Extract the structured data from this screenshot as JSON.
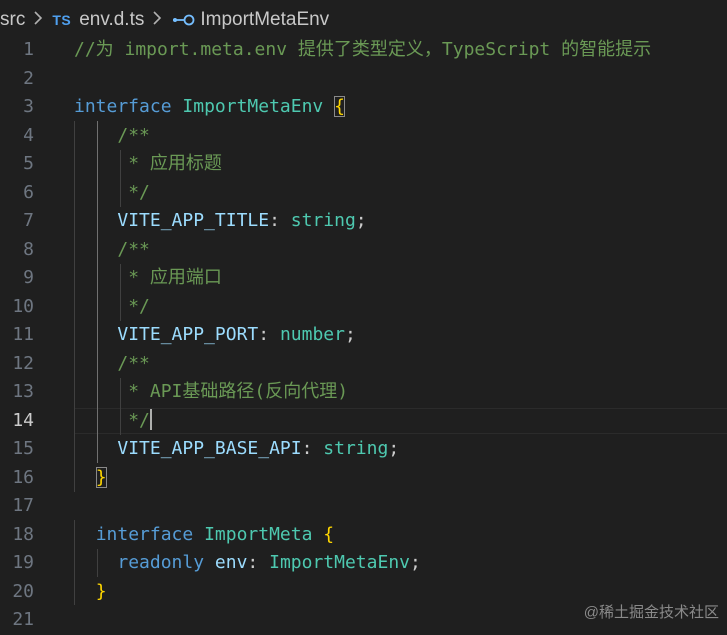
{
  "breadcrumb": {
    "folder": "src",
    "file_badge": "TS",
    "file": "env.d.ts",
    "symbol": "ImportMetaEnv",
    "separator_icon": "chevron-right-icon",
    "symbol_icon": "interface-icon"
  },
  "lines": [
    {
      "n": "1",
      "tokens": [
        {
          "c": "cm",
          "t": "//为 import.meta.env 提供了类型定义，TypeScript 的智能提示"
        }
      ]
    },
    {
      "n": "2",
      "tokens": []
    },
    {
      "n": "3",
      "tokens": [
        {
          "c": "kw",
          "t": "interface"
        },
        {
          "c": "",
          "t": " "
        },
        {
          "c": "ty",
          "t": "ImportMetaEnv"
        },
        {
          "c": "",
          "t": " "
        },
        {
          "c": "br-box",
          "t": "{"
        }
      ]
    },
    {
      "n": "4",
      "tokens": [
        {
          "c": "",
          "t": "    "
        },
        {
          "c": "cm",
          "t": "/**"
        }
      ]
    },
    {
      "n": "5",
      "tokens": [
        {
          "c": "",
          "t": "     "
        },
        {
          "c": "cm",
          "t": "* 应用标题"
        }
      ]
    },
    {
      "n": "6",
      "tokens": [
        {
          "c": "",
          "t": "     "
        },
        {
          "c": "cm",
          "t": "*/"
        }
      ]
    },
    {
      "n": "7",
      "tokens": [
        {
          "c": "",
          "t": "    "
        },
        {
          "c": "var",
          "t": "VITE_APP_TITLE"
        },
        {
          "c": "",
          "t": ": "
        },
        {
          "c": "ty",
          "t": "string"
        },
        {
          "c": "",
          "t": ";"
        }
      ]
    },
    {
      "n": "8",
      "tokens": [
        {
          "c": "",
          "t": "    "
        },
        {
          "c": "cm",
          "t": "/**"
        }
      ]
    },
    {
      "n": "9",
      "tokens": [
        {
          "c": "",
          "t": "     "
        },
        {
          "c": "cm",
          "t": "* 应用端口"
        }
      ]
    },
    {
      "n": "10",
      "tokens": [
        {
          "c": "",
          "t": "     "
        },
        {
          "c": "cm",
          "t": "*/"
        }
      ]
    },
    {
      "n": "11",
      "tokens": [
        {
          "c": "",
          "t": "    "
        },
        {
          "c": "var",
          "t": "VITE_APP_PORT"
        },
        {
          "c": "",
          "t": ": "
        },
        {
          "c": "ty",
          "t": "number"
        },
        {
          "c": "",
          "t": ";"
        }
      ]
    },
    {
      "n": "12",
      "tokens": [
        {
          "c": "",
          "t": "    "
        },
        {
          "c": "cm",
          "t": "/**"
        }
      ]
    },
    {
      "n": "13",
      "tokens": [
        {
          "c": "",
          "t": "     "
        },
        {
          "c": "cm",
          "t": "* API基础路径(反向代理)"
        }
      ]
    },
    {
      "n": "14",
      "tokens": [
        {
          "c": "",
          "t": "     "
        },
        {
          "c": "cm",
          "t": "*/"
        },
        {
          "c": "caret",
          "t": ""
        }
      ]
    },
    {
      "n": "15",
      "tokens": [
        {
          "c": "",
          "t": "    "
        },
        {
          "c": "var",
          "t": "VITE_APP_BASE_API"
        },
        {
          "c": "",
          "t": ": "
        },
        {
          "c": "ty",
          "t": "string"
        },
        {
          "c": "",
          "t": ";"
        }
      ]
    },
    {
      "n": "16",
      "tokens": [
        {
          "c": "",
          "t": "  "
        },
        {
          "c": "br-box",
          "t": "}"
        }
      ]
    },
    {
      "n": "17",
      "tokens": []
    },
    {
      "n": "18",
      "tokens": [
        {
          "c": "",
          "t": "  "
        },
        {
          "c": "kw",
          "t": "interface"
        },
        {
          "c": "",
          "t": " "
        },
        {
          "c": "ty",
          "t": "ImportMeta"
        },
        {
          "c": "",
          "t": " "
        },
        {
          "c": "br",
          "t": "{"
        }
      ]
    },
    {
      "n": "19",
      "tokens": [
        {
          "c": "",
          "t": "    "
        },
        {
          "c": "kw",
          "t": "readonly"
        },
        {
          "c": "",
          "t": " "
        },
        {
          "c": "var",
          "t": "env"
        },
        {
          "c": "",
          "t": ": "
        },
        {
          "c": "ty",
          "t": "ImportMetaEnv"
        },
        {
          "c": "",
          "t": ";"
        }
      ]
    },
    {
      "n": "20",
      "tokens": [
        {
          "c": "",
          "t": "  "
        },
        {
          "c": "br",
          "t": "}"
        }
      ]
    },
    {
      "n": "21",
      "tokens": []
    }
  ],
  "active_line": "14",
  "watermark": "@稀土掘金技术社区"
}
